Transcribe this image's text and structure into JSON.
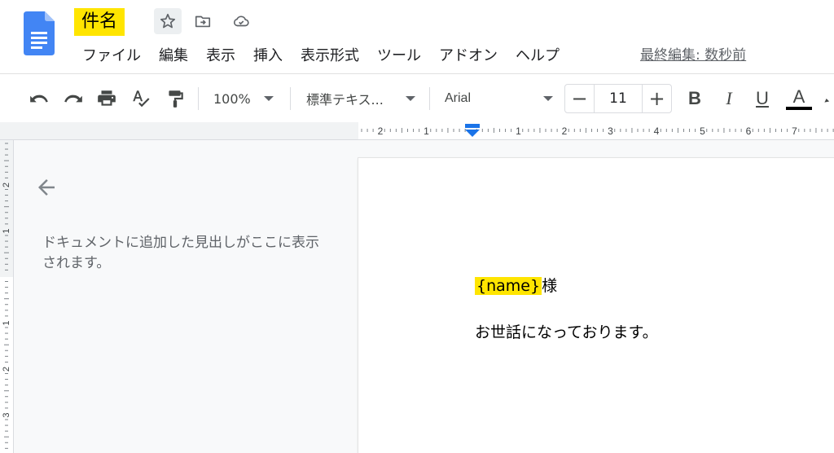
{
  "header": {
    "title": "件名",
    "last_edit": "最終編集: 数秒前"
  },
  "menu": [
    "ファイル",
    "編集",
    "表示",
    "挿入",
    "表示形式",
    "ツール",
    "アドオン",
    "ヘルプ"
  ],
  "toolbar": {
    "zoom": "100%",
    "style": "標準テキス...",
    "font": "Arial",
    "font_size": "11",
    "bold": "B",
    "italic": "I",
    "underline": "U",
    "text_color_letter": "A",
    "text_color": "#000000"
  },
  "ruler": {
    "top_labels": [
      "2",
      "1",
      "1",
      "2",
      "3",
      "4",
      "5",
      "6",
      "7"
    ],
    "side_labels": [
      "2",
      "1",
      "1",
      "2",
      "3"
    ]
  },
  "outline": {
    "hint": "ドキュメントに追加した見出しがここに表示されます。"
  },
  "document": {
    "placeholder": "{name}",
    "honorific": "様",
    "greeting": "お世話になっております。"
  },
  "colors": {
    "highlight": "#ffe500",
    "docs_blue": "#4285f4",
    "indent_marker": "#1a73e8"
  },
  "icons": [
    "docs-logo-icon",
    "star-icon",
    "move-to-folder-icon",
    "cloud-saved-icon",
    "undo-icon",
    "redo-icon",
    "print-icon",
    "spellcheck-icon",
    "paint-format-icon",
    "arrow-left-icon"
  ]
}
